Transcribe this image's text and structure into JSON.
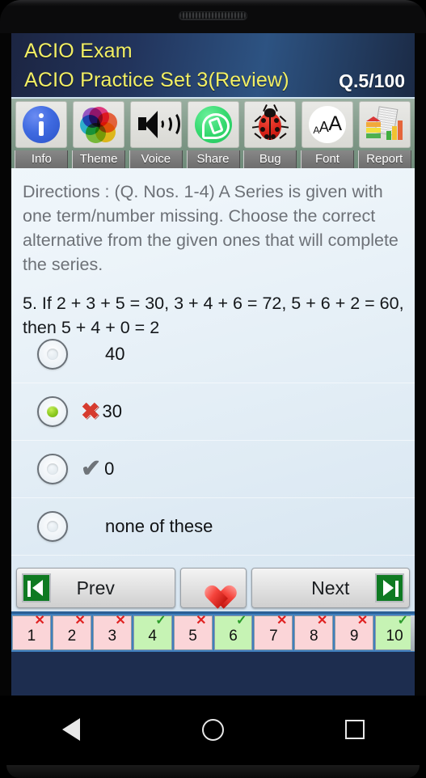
{
  "app": {
    "title": "ACIO Exam",
    "subtitle": "ACIO Practice Set 3(Review)",
    "question_counter": "Q.5/100"
  },
  "toolbar": {
    "items": [
      {
        "label": "Info",
        "icon": "info-icon"
      },
      {
        "label": "Theme",
        "icon": "color-palette-icon"
      },
      {
        "label": "Voice",
        "icon": "speaker-icon"
      },
      {
        "label": "Share",
        "icon": "whatsapp-share-icon"
      },
      {
        "label": "Bug",
        "icon": "ladybug-icon"
      },
      {
        "label": "Font",
        "icon": "font-size-icon"
      },
      {
        "label": "Report",
        "icon": "report-chart-icon"
      }
    ]
  },
  "content": {
    "directions": "Directions : (Q. Nos. 1-4) A Series is given with one term/number missing. Choose the correct alternative from the given ones that will complete the series.",
    "question": "5. If 2 + 3 + 5 = 30, 3 + 4 + 6 = 72, 5 + 6 + 2 = 60, then 5 + 4 + 0 = 2",
    "options": [
      {
        "label": "40",
        "selected": false,
        "mark": ""
      },
      {
        "label": "30",
        "selected": true,
        "mark": "x"
      },
      {
        "label": "0",
        "selected": false,
        "mark": "tick"
      },
      {
        "label": "none of these",
        "selected": false,
        "mark": ""
      }
    ],
    "mark_x_glyph": "✖",
    "mark_tick_glyph": "✔"
  },
  "nav": {
    "prev_label": "Prev",
    "next_label": "Next",
    "favorite_icon": "heart-icon",
    "prev_icon": "skip-to-start-icon",
    "next_icon": "skip-to-end-icon"
  },
  "question_strip": [
    {
      "number": "1",
      "status": "wrong"
    },
    {
      "number": "2",
      "status": "wrong"
    },
    {
      "number": "3",
      "status": "wrong"
    },
    {
      "number": "4",
      "status": "right"
    },
    {
      "number": "5",
      "status": "wrong"
    },
    {
      "number": "6",
      "status": "right"
    },
    {
      "number": "7",
      "status": "wrong"
    },
    {
      "number": "8",
      "status": "wrong"
    },
    {
      "number": "9",
      "status": "wrong"
    },
    {
      "number": "10",
      "status": "right"
    }
  ],
  "badges": {
    "wrong": "✕",
    "right": "✓"
  },
  "system_nav": {
    "back": "back-icon",
    "home": "home-icon",
    "recents": "recents-icon"
  },
  "colors": {
    "header_text": "#f2ef64",
    "toolbar_bg": "#7f9887",
    "content_blue": "#3b83c6",
    "selected_radio": "#8cc920",
    "wrong_mark": "#d63b2e",
    "cell_wrong": "#fbd5d8",
    "cell_right": "#c6f3b4"
  }
}
